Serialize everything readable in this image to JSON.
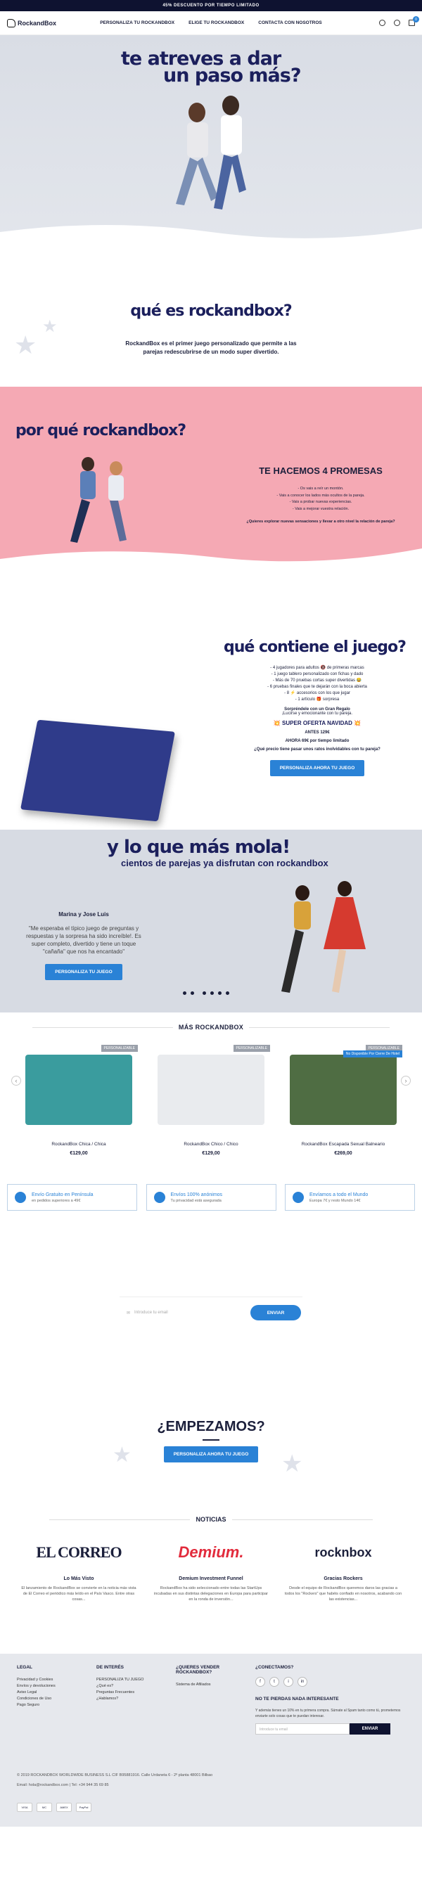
{
  "topbar": {
    "text": "45% DESCUENTO POR TIEMPO LIMITADO"
  },
  "header": {
    "logo": "RockandBox",
    "nav": [
      "PERSONALIZA TU ROCKANDBOX",
      "ELIGE TU ROCKANDBOX",
      "CONTACTA CON NOSOTROS"
    ],
    "cart_count": "0"
  },
  "hero": {
    "line1": "te atreves a dar",
    "line2": "un paso más?"
  },
  "what": {
    "title": "qué es rockandbox?",
    "text1": "RockandBox es el primer juego personalizado que permite a las",
    "text2": "parejas redescubrirse de un modo super divertido."
  },
  "why": {
    "title": "por qué rockandbox?",
    "subtitle": "TE HACEMOS 4 PROMESAS",
    "promises": [
      "- Os vais a reír un montón.",
      "- Vais a conocer los lados más ocultos de la pareja.",
      "- Vais a probar nuevas experiencias.",
      "- Vais a mejorar vuestra relación."
    ],
    "question": "¿Quieres explorar nuevas sensaciones y llevar a otro nivel la relación de pareja?"
  },
  "contains": {
    "title": "qué contiene el juego?",
    "items": [
      "- 4 jugadores para adultos 🔞 de primeras marcas",
      "- 1 juego tablero personalizado con fichas y dado",
      "- Más de 70 pruebas cortas super divertidas 😂",
      "- 6 pruebas finales que te dejarán con la boca abierta",
      "- 8 ⚡ accesorios con los que jugar",
      "- 1 artículo 🎁 sorpresa"
    ],
    "surprise1": "Sorpréndele con un Gran Regalo",
    "surprise2": "¡Lucirse y emocionante con tu pareja.",
    "offer": "💥 SUPER OFERTA NAVIDAD 💥",
    "before": "ANTES 129€",
    "now": "AHORA 69€ por tiempo limitado",
    "question": "¿Qué precio tiene pasar unos ratos inolvidables con tu pareja?",
    "cta": "PERSONALIZA AHORA TU JUEGO"
  },
  "mola": {
    "title": "y lo que más mola!",
    "subtitle": "cientos de parejas ya disfrutan con rockandbox",
    "testimonial_name": "Marina y Jose Luis",
    "testimonial": "\"Me esperaba el típico juego de preguntas y respuestas y la sorpresa ha sido increíble!. Es super completo, divertido y tiene un toque \"cañaña\" que nos ha encantado\"",
    "cta": "PERSONALIZA TU JUEGO"
  },
  "more": {
    "title": "MÁS ROCKANDBOX",
    "products": [
      {
        "name": "RockandBox Chica / Chica",
        "price": "€129,00",
        "tag": "PERSONALIZABLE",
        "tag2": "",
        "color": "#3a9c9e"
      },
      {
        "name": "RockandBox Chico / Chico",
        "price": "€129,00",
        "tag": "PERSONALIZABLE",
        "tag2": "",
        "color": "#e9ebee"
      },
      {
        "name": "RockandBox Escapada Sexual Balneario",
        "price": "€269,00",
        "tag": "PERSONALIZABLE",
        "tag2": "No Disponible Por Cierre De Hotel",
        "color": "#4f6d43"
      }
    ],
    "features": [
      {
        "title": "Envío Gratuito en Península",
        "sub": "en pedidos superiores a 49€"
      },
      {
        "title": "Envíos 100% anónimos",
        "sub": "Tu privacidad está asegurada"
      },
      {
        "title": "Envíamos a todo el Mundo",
        "sub": "Europa 7€ y resto Mundo 14€"
      }
    ]
  },
  "newsletter": {
    "placeholder": "Introduce tu email",
    "button": "ENVIAR"
  },
  "start": {
    "title": "¿EMPEZAMOS?",
    "cta": "PERSONALIZA AHORA TU JUEGO"
  },
  "news": {
    "title": "NOTICIAS",
    "items": [
      {
        "logo": "EL CORREO",
        "heading": "Lo Más Visto",
        "text": "El lanzamiento de RockandBox se convierte en la noticia más vista de El Correo el periódico más leído en el País Vasco. Entre otras cosas..."
      },
      {
        "logo": "Demium.",
        "heading": "Demium Investment Funnel",
        "text": "RockandBox ha sido seleccionado entre todas las StartUps incubadas en sus distintas delegaciones en Europa para participar en la ronda de inversión..."
      },
      {
        "logo": "rocknbox",
        "heading": "Gracias Rockers",
        "text": "Desde el equipo de RockandBox queremos daros las gracias a todos los \"Rockers\" que habéis confiado en nosotros, acabando con las existencias..."
      }
    ]
  },
  "footer": {
    "legal_title": "LEGAL",
    "legal": [
      "Privacidad y Cookies",
      "Envíos y devoluciones",
      "Aviso Legal",
      "Condiciones de Uso",
      "Pago Seguro"
    ],
    "interest_title": "DE INTERÉS",
    "interest": [
      "PERSONALIZA TU JUEGO",
      "¿Qué es?",
      "Preguntas Frecuentes",
      "¿Hablamos?"
    ],
    "sell_title": "¿QUIERES VENDER ROCKANDBOX?",
    "sell": [
      "Sistema de Afiliados"
    ],
    "connect_title": "¿CONECTAMOS?",
    "social": [
      "f",
      "t",
      "i",
      "in"
    ],
    "nl_title": "NO TE PIERDAS NADA INTERESANTE",
    "nl_text": "Y además tienes un 10% en tu primera compra. Súmate al Spam tanto como tú, prometemos enviarte solo cosas que te puedan interesar.",
    "nl_placeholder": "Introduce tu email",
    "nl_button": "ENVIAR",
    "copyright": "© 2019 ROCKANDBOX WORLDWIDE BUSINESS S.L CIF B95881916. Calle Urdaneta 6 - 2º planta 48001 Bilbao",
    "contact": "Email: hola@rockandbox.com | Tel: +34 944 35 69 85",
    "payments": [
      "VISA",
      "MC",
      "AMEX",
      "PayPal"
    ]
  }
}
